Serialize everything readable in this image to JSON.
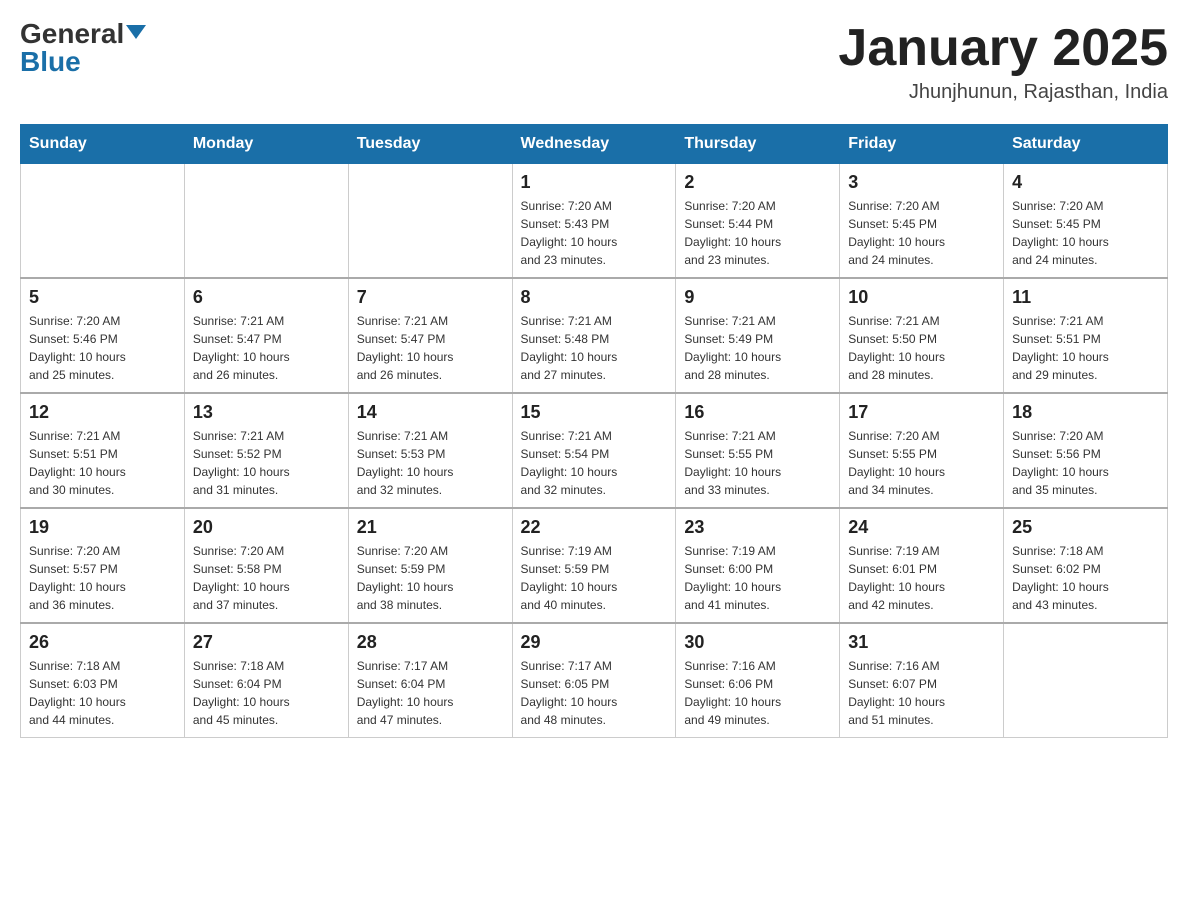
{
  "header": {
    "logo_general": "General",
    "logo_blue": "Blue",
    "title": "January 2025",
    "subtitle": "Jhunjhunun, Rajasthan, India"
  },
  "weekdays": [
    "Sunday",
    "Monday",
    "Tuesday",
    "Wednesday",
    "Thursday",
    "Friday",
    "Saturday"
  ],
  "weeks": [
    [
      {
        "day": "",
        "info": ""
      },
      {
        "day": "",
        "info": ""
      },
      {
        "day": "",
        "info": ""
      },
      {
        "day": "1",
        "info": "Sunrise: 7:20 AM\nSunset: 5:43 PM\nDaylight: 10 hours\nand 23 minutes."
      },
      {
        "day": "2",
        "info": "Sunrise: 7:20 AM\nSunset: 5:44 PM\nDaylight: 10 hours\nand 23 minutes."
      },
      {
        "day": "3",
        "info": "Sunrise: 7:20 AM\nSunset: 5:45 PM\nDaylight: 10 hours\nand 24 minutes."
      },
      {
        "day": "4",
        "info": "Sunrise: 7:20 AM\nSunset: 5:45 PM\nDaylight: 10 hours\nand 24 minutes."
      }
    ],
    [
      {
        "day": "5",
        "info": "Sunrise: 7:20 AM\nSunset: 5:46 PM\nDaylight: 10 hours\nand 25 minutes."
      },
      {
        "day": "6",
        "info": "Sunrise: 7:21 AM\nSunset: 5:47 PM\nDaylight: 10 hours\nand 26 minutes."
      },
      {
        "day": "7",
        "info": "Sunrise: 7:21 AM\nSunset: 5:47 PM\nDaylight: 10 hours\nand 26 minutes."
      },
      {
        "day": "8",
        "info": "Sunrise: 7:21 AM\nSunset: 5:48 PM\nDaylight: 10 hours\nand 27 minutes."
      },
      {
        "day": "9",
        "info": "Sunrise: 7:21 AM\nSunset: 5:49 PM\nDaylight: 10 hours\nand 28 minutes."
      },
      {
        "day": "10",
        "info": "Sunrise: 7:21 AM\nSunset: 5:50 PM\nDaylight: 10 hours\nand 28 minutes."
      },
      {
        "day": "11",
        "info": "Sunrise: 7:21 AM\nSunset: 5:51 PM\nDaylight: 10 hours\nand 29 minutes."
      }
    ],
    [
      {
        "day": "12",
        "info": "Sunrise: 7:21 AM\nSunset: 5:51 PM\nDaylight: 10 hours\nand 30 minutes."
      },
      {
        "day": "13",
        "info": "Sunrise: 7:21 AM\nSunset: 5:52 PM\nDaylight: 10 hours\nand 31 minutes."
      },
      {
        "day": "14",
        "info": "Sunrise: 7:21 AM\nSunset: 5:53 PM\nDaylight: 10 hours\nand 32 minutes."
      },
      {
        "day": "15",
        "info": "Sunrise: 7:21 AM\nSunset: 5:54 PM\nDaylight: 10 hours\nand 32 minutes."
      },
      {
        "day": "16",
        "info": "Sunrise: 7:21 AM\nSunset: 5:55 PM\nDaylight: 10 hours\nand 33 minutes."
      },
      {
        "day": "17",
        "info": "Sunrise: 7:20 AM\nSunset: 5:55 PM\nDaylight: 10 hours\nand 34 minutes."
      },
      {
        "day": "18",
        "info": "Sunrise: 7:20 AM\nSunset: 5:56 PM\nDaylight: 10 hours\nand 35 minutes."
      }
    ],
    [
      {
        "day": "19",
        "info": "Sunrise: 7:20 AM\nSunset: 5:57 PM\nDaylight: 10 hours\nand 36 minutes."
      },
      {
        "day": "20",
        "info": "Sunrise: 7:20 AM\nSunset: 5:58 PM\nDaylight: 10 hours\nand 37 minutes."
      },
      {
        "day": "21",
        "info": "Sunrise: 7:20 AM\nSunset: 5:59 PM\nDaylight: 10 hours\nand 38 minutes."
      },
      {
        "day": "22",
        "info": "Sunrise: 7:19 AM\nSunset: 5:59 PM\nDaylight: 10 hours\nand 40 minutes."
      },
      {
        "day": "23",
        "info": "Sunrise: 7:19 AM\nSunset: 6:00 PM\nDaylight: 10 hours\nand 41 minutes."
      },
      {
        "day": "24",
        "info": "Sunrise: 7:19 AM\nSunset: 6:01 PM\nDaylight: 10 hours\nand 42 minutes."
      },
      {
        "day": "25",
        "info": "Sunrise: 7:18 AM\nSunset: 6:02 PM\nDaylight: 10 hours\nand 43 minutes."
      }
    ],
    [
      {
        "day": "26",
        "info": "Sunrise: 7:18 AM\nSunset: 6:03 PM\nDaylight: 10 hours\nand 44 minutes."
      },
      {
        "day": "27",
        "info": "Sunrise: 7:18 AM\nSunset: 6:04 PM\nDaylight: 10 hours\nand 45 minutes."
      },
      {
        "day": "28",
        "info": "Sunrise: 7:17 AM\nSunset: 6:04 PM\nDaylight: 10 hours\nand 47 minutes."
      },
      {
        "day": "29",
        "info": "Sunrise: 7:17 AM\nSunset: 6:05 PM\nDaylight: 10 hours\nand 48 minutes."
      },
      {
        "day": "30",
        "info": "Sunrise: 7:16 AM\nSunset: 6:06 PM\nDaylight: 10 hours\nand 49 minutes."
      },
      {
        "day": "31",
        "info": "Sunrise: 7:16 AM\nSunset: 6:07 PM\nDaylight: 10 hours\nand 51 minutes."
      },
      {
        "day": "",
        "info": ""
      }
    ]
  ]
}
